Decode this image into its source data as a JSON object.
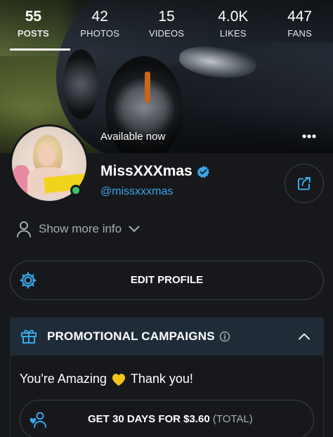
{
  "stats": [
    {
      "value": "55",
      "label": "POSTS",
      "active": true
    },
    {
      "value": "42",
      "label": "PHOTOS"
    },
    {
      "value": "15",
      "label": "VIDEOS"
    },
    {
      "value": "4.0K",
      "label": "LIKES"
    },
    {
      "value": "447",
      "label": "FANS"
    }
  ],
  "cover": {
    "status": "Available now",
    "more_icon": "more-horizontal-icon"
  },
  "profile": {
    "name": "MissXXXmas",
    "handle": "@missxxxmas",
    "verified": true,
    "online": true,
    "verified_color": "#3aa6e8",
    "online_color": "#3dc66a"
  },
  "show_more": {
    "label": "Show more info",
    "icon": "user-icon"
  },
  "edit_profile": {
    "label": "EDIT PROFILE",
    "icon": "gear-icon"
  },
  "promotional": {
    "title": "PROMOTIONAL CAMPAIGNS",
    "icon": "gift-icon",
    "message_before": "You're Amazing",
    "message_after": "Thank you!",
    "heart_color": "#f5c518",
    "subscribe": {
      "label": "GET 30 DAYS FOR $3.60",
      "suffix": "(TOTAL)",
      "icon": "user-heart-icon"
    }
  },
  "colors": {
    "background": "#16181c",
    "accent": "#3aa6e8",
    "promo_header": "#1f2c38"
  }
}
